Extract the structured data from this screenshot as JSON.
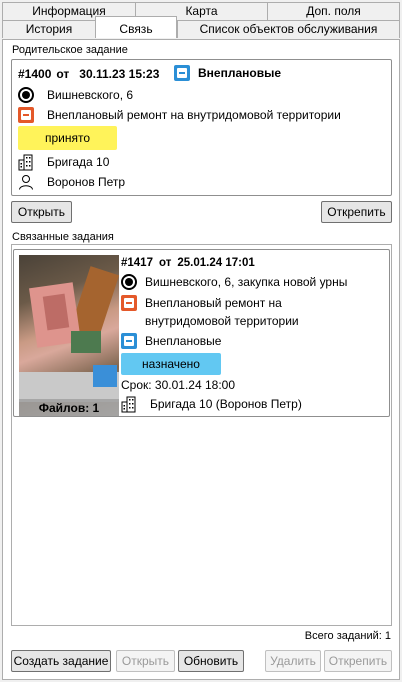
{
  "tabs": {
    "row1": [
      "Информация",
      "Карта",
      "Доп. поля"
    ],
    "row2": [
      "История",
      "Связь",
      "Список объектов обслуживания"
    ],
    "active": "Связь"
  },
  "parent": {
    "group_title": "Родительское задание",
    "number": "#1400",
    "from": "от",
    "date": "30.11.23 15:23",
    "category": "Внеплановые",
    "address": "Вишневского, 6",
    "work_type": "Внеплановый ремонт на внутридомовой территории",
    "status": "принято",
    "status_color": "#fff35a",
    "brigade": "Бригада 10",
    "person": "Воронов Петр",
    "open_button": "Открыть",
    "unpin_button": "Открепить"
  },
  "linked": {
    "group_title": "Связанные задания",
    "items": [
      {
        "number": "#1417",
        "from": "от",
        "date": "25.01.24 17:01",
        "address": "Вишневского, 6, закупка новой урны",
        "work_type_line1": "Внеплановый ремонт на",
        "work_type_line2": "внутридомовой территории",
        "category": "Внеплановые",
        "status": "назначено",
        "status_color": "#62c8f2",
        "deadline": "Срок: 30.01.24 18:00",
        "brigade": "Бригада 10  (Воронов Петр)",
        "files": "Файлов: 1"
      }
    ],
    "total": "Всего заданий: 1"
  },
  "footer": {
    "create": "Создать задание",
    "open": "Открыть",
    "refresh": "Обновить",
    "delete": "Удалить",
    "unpin": "Открепить"
  },
  "icons": {
    "address": "radio-target-icon",
    "work_type": "orange-task-icon",
    "category": "blue-calendar-icon",
    "brigade": "building-icon",
    "person": "person-icon"
  }
}
